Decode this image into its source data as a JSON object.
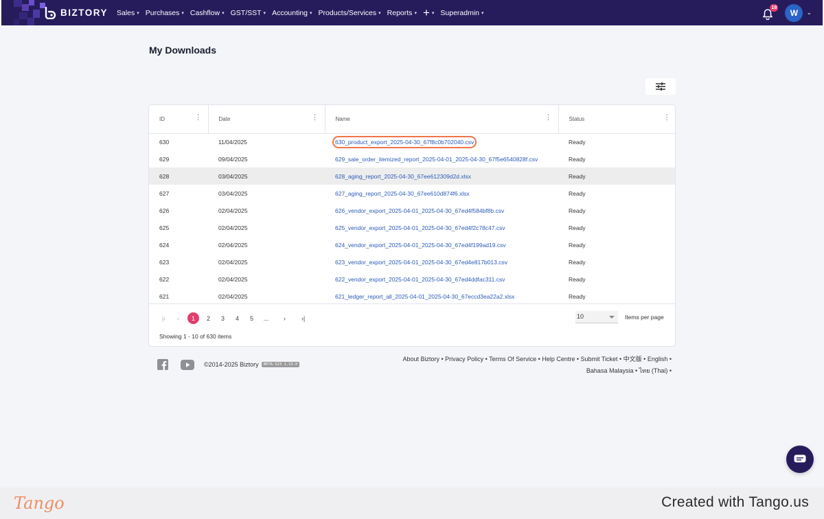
{
  "brand": {
    "name": "BIZTORY"
  },
  "nav": {
    "items": [
      {
        "label": "Sales"
      },
      {
        "label": "Purchases"
      },
      {
        "label": "Cashflow"
      },
      {
        "label": "GST/SST"
      },
      {
        "label": "Accounting"
      },
      {
        "label": "Products/Services"
      },
      {
        "label": "Reports"
      },
      {
        "label": "+"
      },
      {
        "label": "Superadmin"
      }
    ]
  },
  "notifications": {
    "count": "18"
  },
  "user": {
    "initial": "W"
  },
  "page": {
    "title": "My Downloads"
  },
  "table": {
    "columns": [
      "ID",
      "Date",
      "Name",
      "Status"
    ],
    "rows": [
      {
        "id": "630",
        "date": "11/04/2025",
        "name": "630_product_export_2025-04-30_67f8c0b702040.csv",
        "status": "Ready"
      },
      {
        "id": "629",
        "date": "09/04/2025",
        "name": "629_sale_order_itemized_report_2025-04-01_2025-04-30_67f5e6540828f.csv",
        "status": "Ready"
      },
      {
        "id": "628",
        "date": "03/04/2025",
        "name": "628_aging_report_2025-04-30_67ee612309d2d.xlsx",
        "status": "Ready"
      },
      {
        "id": "627",
        "date": "03/04/2025",
        "name": "627_aging_report_2025-04-30_67ee610d874f6.xlsx",
        "status": "Ready"
      },
      {
        "id": "626",
        "date": "02/04/2025",
        "name": "626_vendor_export_2025-04-01_2025-04-30_67ed4f584bf8b.csv",
        "status": "Ready"
      },
      {
        "id": "625",
        "date": "02/04/2025",
        "name": "625_vendor_export_2025-04-01_2025-04-30_67ed4f2c78c47.csv",
        "status": "Ready"
      },
      {
        "id": "624",
        "date": "02/04/2025",
        "name": "624_vendor_export_2025-04-01_2025-04-30_67ed4f199ad19.csv",
        "status": "Ready"
      },
      {
        "id": "623",
        "date": "02/04/2025",
        "name": "623_vendor_export_2025-04-01_2025-04-30_67ed4e817b013.csv",
        "status": "Ready"
      },
      {
        "id": "622",
        "date": "02/04/2025",
        "name": "622_vendor_export_2025-04-01_2025-04-30_67ed4ddfac311.csv",
        "status": "Ready"
      },
      {
        "id": "621",
        "date": "02/04/2025",
        "name": "621_ledger_report_all_2025-04-01_2025-04-30_67eccd3ea22a2.xlsx",
        "status": "Ready"
      }
    ]
  },
  "pagination": {
    "first": "|‹",
    "prev": "‹",
    "pages": [
      "1",
      "2",
      "3",
      "4",
      "5",
      "..."
    ],
    "next": "›",
    "last": "›|",
    "current_page": "1",
    "items_per_page_value": "10",
    "items_per_page_label": "Items per page",
    "showing": "Showing 1 - 10 of 630 items"
  },
  "footer": {
    "copyright": "©2014-2025 Biztory",
    "version": "BETA-S23 1.13.0",
    "links_line1": "About Biztory • Privacy Policy • Terms Of Service • Help Centre • Submit Ticket • 中文版 • English •",
    "links_line2": "Bahasa Malaysia • ไทย (Thai) •"
  },
  "tango": {
    "logo": "Tango",
    "created": "Created with Tango.us"
  },
  "colors": {
    "topbar": "#261c5c",
    "accent": "#e23d6c",
    "link": "#2a5ab8",
    "highlight_ring": "#f0744a"
  }
}
